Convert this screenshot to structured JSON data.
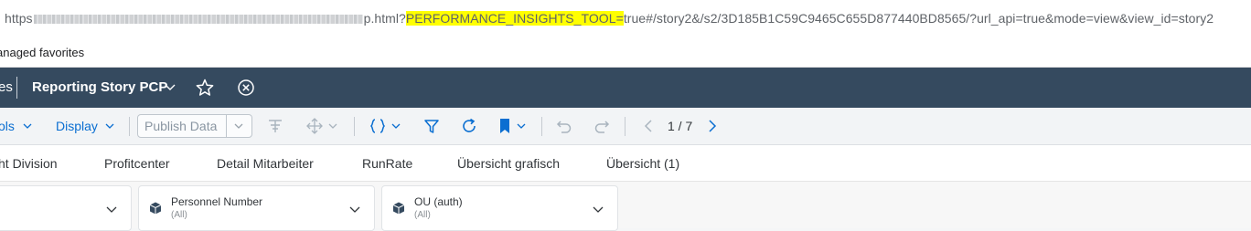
{
  "url": {
    "prefix": "https",
    "middle": "p.html?",
    "highlight": "PERFORMANCE_INSIGHTS_TOOL=",
    "suffix": "true#/story2&/s2/3D185B1C59C9465C655D877440BD8565/?url_api=true&mode=view&view_id=story2"
  },
  "favorites": {
    "label": "anaged favorites"
  },
  "shell": {
    "prev_crumb": "es",
    "title": "Reporting Story PCP"
  },
  "toolbar": {
    "tools_label": "ols",
    "display_label": "Display",
    "publish_label": "Publish Data",
    "page_indicator": "1 / 7"
  },
  "tabs": [
    {
      "label": "ht Division"
    },
    {
      "label": "Profitcenter"
    },
    {
      "label": "Detail Mitarbeiter"
    },
    {
      "label": "RunRate"
    },
    {
      "label": "Übersicht grafisch"
    },
    {
      "label": "Übersicht (1)"
    }
  ],
  "filters": [
    {
      "label": "",
      "value": ""
    },
    {
      "label": "Personnel Number",
      "value": "(All)"
    },
    {
      "label": "OU (auth)",
      "value": "(All)"
    }
  ],
  "colors": {
    "shell_bg": "#354a5f",
    "accent": "#0a6ed1",
    "highlight": "#ffff00"
  }
}
